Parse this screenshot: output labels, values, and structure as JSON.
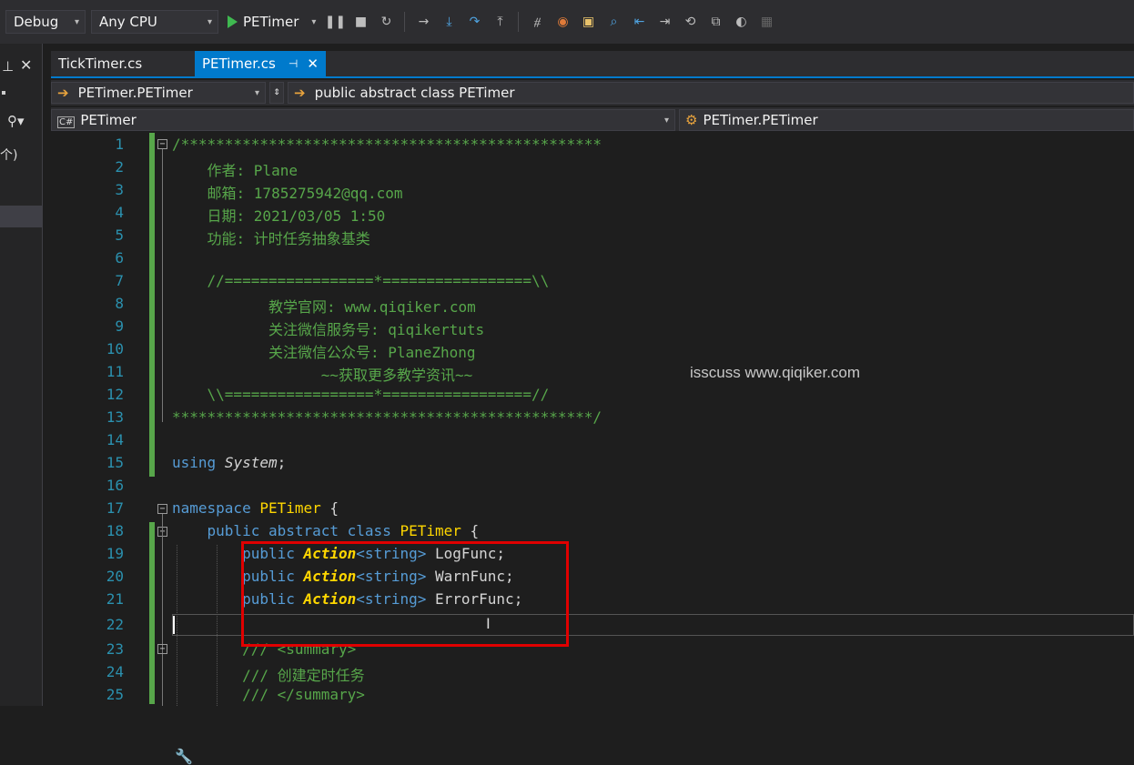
{
  "toolbar": {
    "config": "Debug",
    "platform": "Any CPU",
    "run_label": "PETimer"
  },
  "left_panel": {
    "text": "个)"
  },
  "tabs": [
    {
      "label": "TickTimer.cs",
      "active": false
    },
    {
      "label": "PETimer.cs",
      "active": true
    }
  ],
  "nav": {
    "project": "PETimer.PETimer",
    "member": "public abstract class PETimer",
    "file_scope": "PETimer",
    "type_scope": "PETimer.PETimer"
  },
  "editor": {
    "line_numbers": [
      "1",
      "2",
      "3",
      "4",
      "5",
      "6",
      "7",
      "8",
      "9",
      "10",
      "11",
      "12",
      "13",
      "14",
      "15",
      "16",
      "17",
      "18",
      "19",
      "20",
      "21",
      "22",
      "23",
      "24",
      "25"
    ],
    "lines": {
      "l1": "/************************************************",
      "l2": "    作者: Plane",
      "l3": "    邮箱: 1785275942@qq.com",
      "l4": "    日期: 2021/03/05 1:50",
      "l5": "    功能: 计时任务抽象基类",
      "l7": "    //=================*=================\\\\",
      "l8": "           教学官网: www.qiqiker.com",
      "l9": "           关注微信服务号: qiqikertuts",
      "l10": "           关注微信公众号: PlaneZhong",
      "l11": "                 ~~获取更多教学资讯~~",
      "l12": "    \\\\=================*=================//",
      "l13": "************************************************/",
      "l15_kw": "using",
      "l15_id": "System",
      "l15_end": ";",
      "l17_kw": "namespace",
      "l17_id": "PETimer",
      "l17_end": " {",
      "l18_kw": "public abstract class",
      "l18_id": "PETimer",
      "l18_end": " {",
      "l19": {
        "kw": "public",
        "type": "Action",
        "generic": "<string>",
        "name": " LogFunc;"
      },
      "l20": {
        "kw": "public",
        "type": "Action",
        "generic": "<string>",
        "name": " WarnFunc;"
      },
      "l21": {
        "kw": "public",
        "type": "Action",
        "generic": "<string>",
        "name": " ErrorFunc;"
      },
      "l23": "/// <summary>",
      "l24": "/// 创建定时任务",
      "l25": "/// </summary>"
    }
  },
  "watermark": "isscuss www.qiqiker.com",
  "colors": {
    "comment": "#57a64a",
    "keyword": "#569cd6",
    "type": "#ffd700",
    "line_number": "#2b91af",
    "accent": "#007acc",
    "highlight_box": "#e00000"
  }
}
